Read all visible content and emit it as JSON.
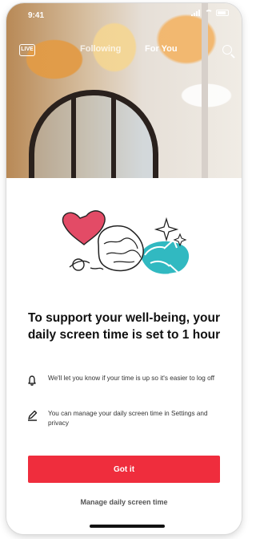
{
  "status_bar": {
    "time": "9:41"
  },
  "top_nav": {
    "live_label": "LIVE",
    "tabs": [
      {
        "label": "Following"
      },
      {
        "label": "For You"
      }
    ]
  },
  "dialog": {
    "headline": "To support your well-being, your daily screen time is set to 1 hour",
    "items": [
      {
        "icon": "bell-icon",
        "text": "We'll let you know if your time is up so it's easier to log off"
      },
      {
        "icon": "pen-icon",
        "text": "You can manage your daily screen time in Settings and privacy"
      }
    ],
    "primary_button": "Got it",
    "secondary_button": "Manage daily screen time"
  },
  "colors": {
    "accent": "#ef2d3d",
    "teal_blob": "#31b9c1",
    "heart": "#e34b66"
  }
}
